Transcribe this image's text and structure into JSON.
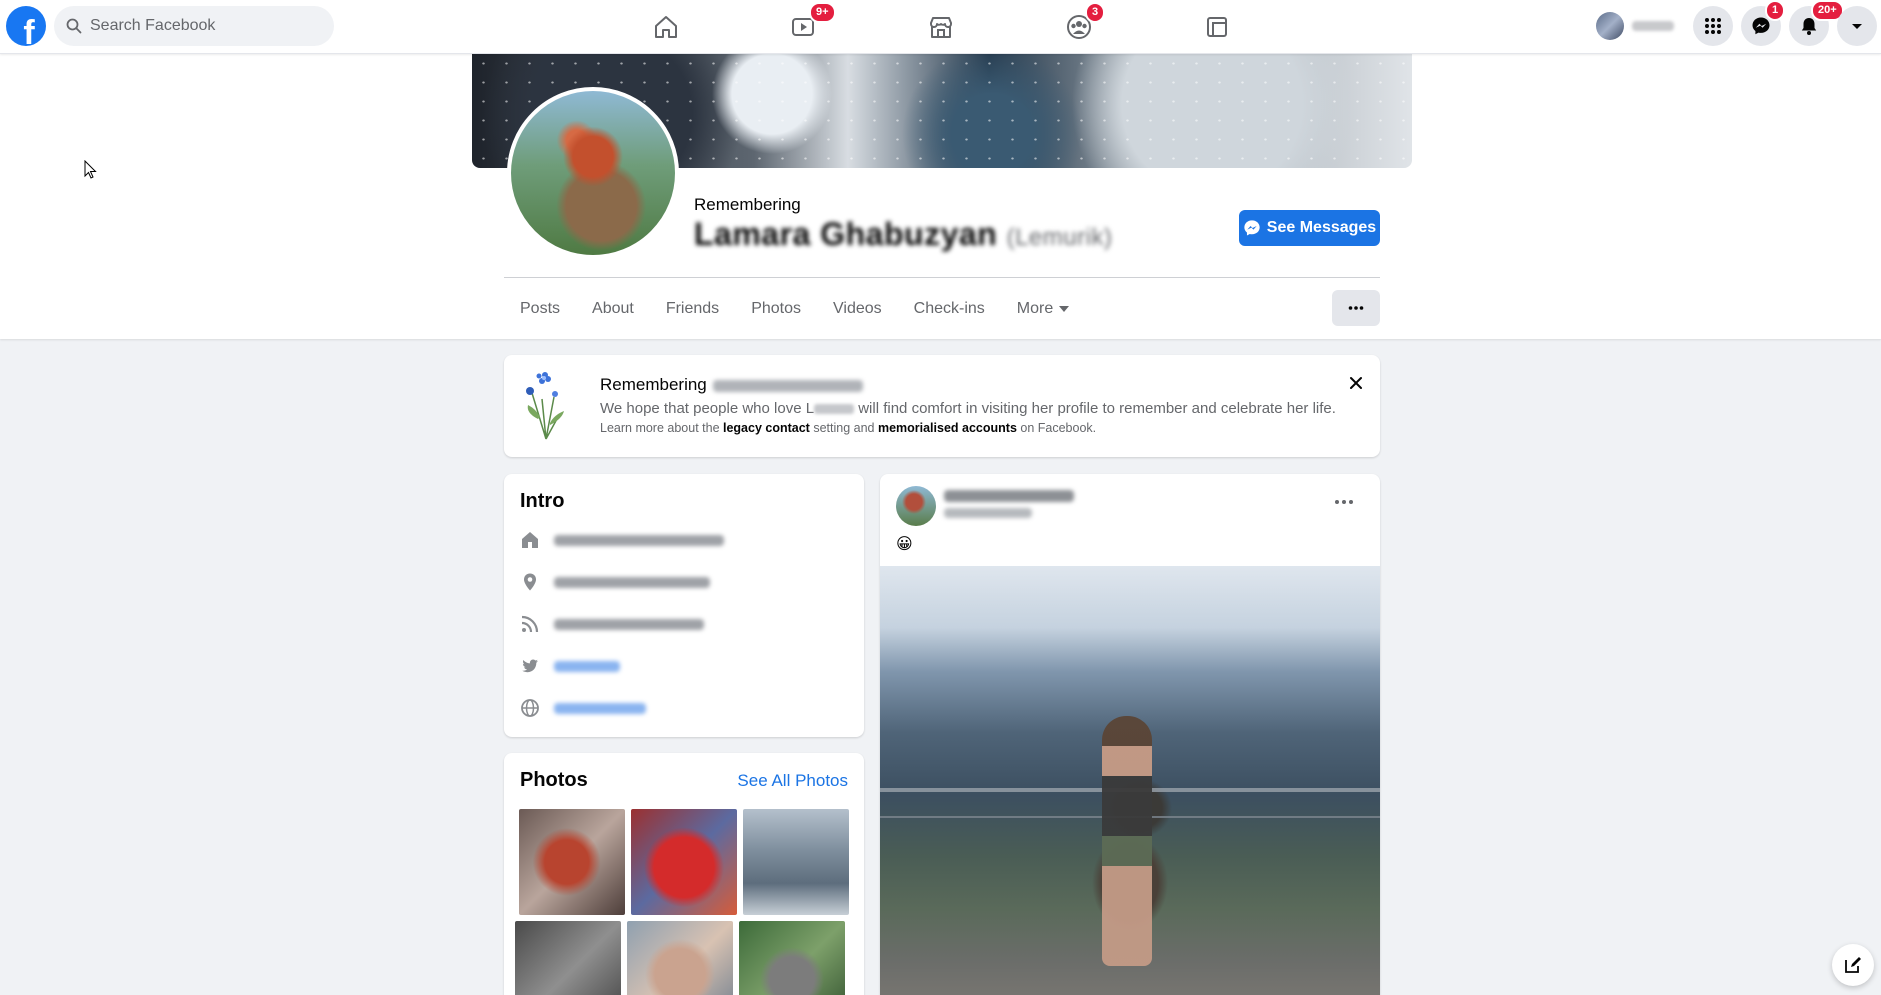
{
  "topbar": {
    "logo": "f",
    "search_placeholder": "Search Facebook",
    "nav": [
      {
        "name": "home",
        "icon": "home-icon"
      },
      {
        "name": "watch",
        "icon": "video-icon",
        "badge": "9+"
      },
      {
        "name": "marketplace",
        "icon": "store-icon"
      },
      {
        "name": "groups",
        "icon": "groups-icon",
        "badge": "3"
      },
      {
        "name": "gaming",
        "icon": "gaming-icon"
      }
    ],
    "messenger_badge": "1",
    "notifications_badge": "20+"
  },
  "profile": {
    "remembering_label": "Remembering",
    "name": "Lamara Ghabuzyan",
    "nickname": "(Lemurik)",
    "see_messages_label": "See Messages"
  },
  "tabs": [
    "Posts",
    "About",
    "Friends",
    "Photos",
    "Videos",
    "Check-ins",
    "More"
  ],
  "memorial": {
    "title": "Remembering",
    "text_before": "We hope that people who love L",
    "text_after": " will find comfort in visiting her profile to remember and celebrate her life.",
    "small_1": "Learn more about the ",
    "legacy_contact": "legacy contact",
    "small_2": " setting and ",
    "memorialised_accounts": "memorialised accounts",
    "small_3": " on Facebook."
  },
  "intro": {
    "title": "Intro"
  },
  "photos": {
    "title": "Photos",
    "see_all": "See All Photos"
  },
  "post": {
    "emoji": "😀"
  },
  "colors": {
    "brand": "#1877f2",
    "badge": "#e41e3f",
    "link": "#1b74e4"
  }
}
